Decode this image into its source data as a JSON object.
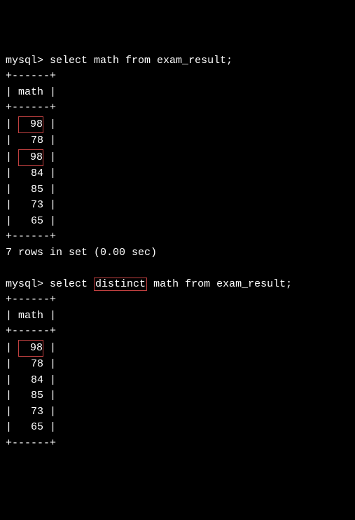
{
  "query1": {
    "prompt": "mysql>",
    "command": "select math from exam_result;",
    "border_top": "+------+",
    "header_line": "| math |",
    "border_mid": "+------+",
    "rows": [
      {
        "value": "98",
        "highlighted": true
      },
      {
        "value": "78",
        "highlighted": false
      },
      {
        "value": "98",
        "highlighted": true
      },
      {
        "value": "84",
        "highlighted": false
      },
      {
        "value": "85",
        "highlighted": false
      },
      {
        "value": "73",
        "highlighted": false
      },
      {
        "value": "65",
        "highlighted": false
      }
    ],
    "border_bot": "+------+",
    "status": "7 rows in set (0.00 sec)"
  },
  "query2": {
    "prompt": "mysql>",
    "cmd_before": "select ",
    "cmd_hl": "distinct",
    "cmd_after": " math from exam_result;",
    "border_top": "+------+",
    "header_line": "| math |",
    "border_mid": "+------+",
    "rows": [
      {
        "value": "98",
        "highlighted": true
      },
      {
        "value": "78",
        "highlighted": false
      },
      {
        "value": "84",
        "highlighted": false
      },
      {
        "value": "85",
        "highlighted": false
      },
      {
        "value": "73",
        "highlighted": false
      },
      {
        "value": "65",
        "highlighted": false
      }
    ],
    "border_bot": "+------+"
  },
  "row_prefix": "| ",
  "row_suffix": " |"
}
